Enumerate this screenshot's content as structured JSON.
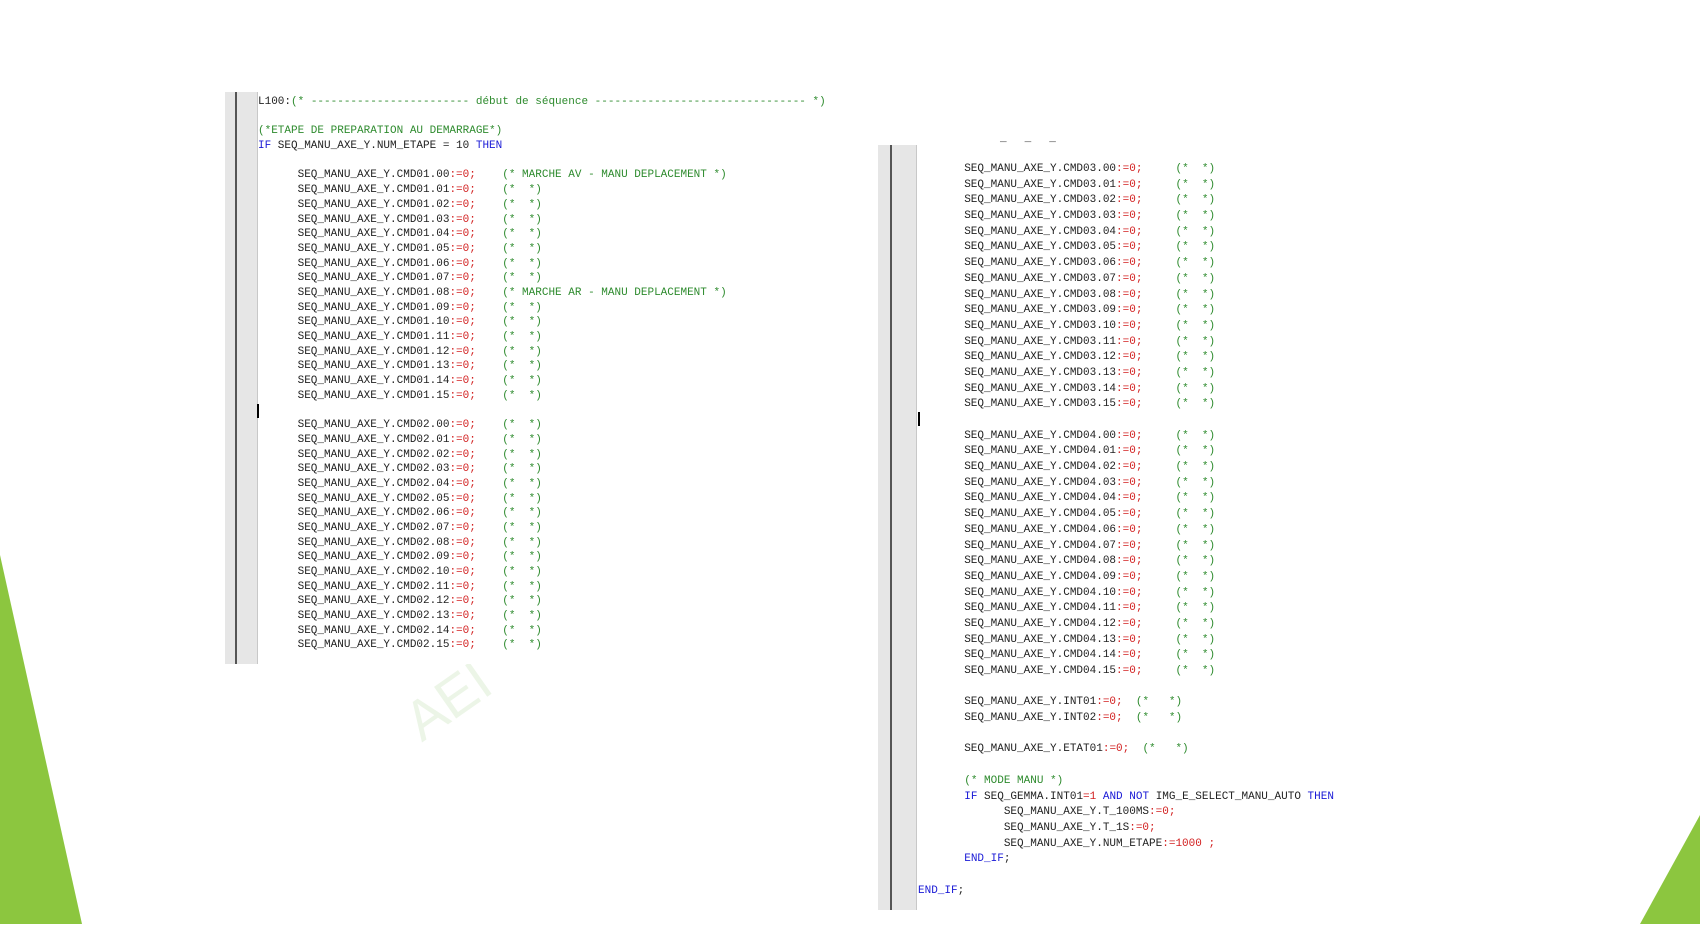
{
  "watermark": "AEI",
  "colors": {
    "comment": "#2e8b2e",
    "keyword": "#1a1ad6",
    "number": "#d22020",
    "text": "#222222",
    "accent_green": "#8cc63f"
  },
  "left_code": [
    [
      [
        "L100:",
        "p"
      ],
      [
        "(* ------------------------ début de séquence -------------------------------- *)",
        "c"
      ]
    ],
    [],
    [
      [
        "(*ETAPE DE PREPARATION AU DEMARRAGE*)",
        "c"
      ]
    ],
    [
      [
        "IF",
        "k"
      ],
      [
        " SEQ_MANU_AXE_Y.NUM_ETAPE = 10 ",
        "p"
      ],
      [
        "THEN",
        "k"
      ]
    ],
    [],
    [
      [
        "      SEQ_MANU_AXE_Y.CMD01.00",
        "p"
      ],
      [
        ":=0;",
        "n"
      ],
      [
        "    ",
        "p"
      ],
      [
        "(* MARCHE AV - MANU DEPLACEMENT *)",
        "c"
      ]
    ],
    [
      [
        "      SEQ_MANU_AXE_Y.CMD01.01",
        "p"
      ],
      [
        ":=0;",
        "n"
      ],
      [
        "    ",
        "p"
      ],
      [
        "(*  *)",
        "c"
      ]
    ],
    [
      [
        "      SEQ_MANU_AXE_Y.CMD01.02",
        "p"
      ],
      [
        ":=0;",
        "n"
      ],
      [
        "    ",
        "p"
      ],
      [
        "(*  *)",
        "c"
      ]
    ],
    [
      [
        "      SEQ_MANU_AXE_Y.CMD01.03",
        "p"
      ],
      [
        ":=0;",
        "n"
      ],
      [
        "    ",
        "p"
      ],
      [
        "(*  *)",
        "c"
      ]
    ],
    [
      [
        "      SEQ_MANU_AXE_Y.CMD01.04",
        "p"
      ],
      [
        ":=0;",
        "n"
      ],
      [
        "    ",
        "p"
      ],
      [
        "(*  *)",
        "c"
      ]
    ],
    [
      [
        "      SEQ_MANU_AXE_Y.CMD01.05",
        "p"
      ],
      [
        ":=0;",
        "n"
      ],
      [
        "    ",
        "p"
      ],
      [
        "(*  *)",
        "c"
      ]
    ],
    [
      [
        "      SEQ_MANU_AXE_Y.CMD01.06",
        "p"
      ],
      [
        ":=0;",
        "n"
      ],
      [
        "    ",
        "p"
      ],
      [
        "(*  *)",
        "c"
      ]
    ],
    [
      [
        "      SEQ_MANU_AXE_Y.CMD01.07",
        "p"
      ],
      [
        ":=0;",
        "n"
      ],
      [
        "    ",
        "p"
      ],
      [
        "(*  *)",
        "c"
      ]
    ],
    [
      [
        "      SEQ_MANU_AXE_Y.CMD01.08",
        "p"
      ],
      [
        ":=0;",
        "n"
      ],
      [
        "    ",
        "p"
      ],
      [
        "(* MARCHE AR - MANU DEPLACEMENT *)",
        "c"
      ]
    ],
    [
      [
        "      SEQ_MANU_AXE_Y.CMD01.09",
        "p"
      ],
      [
        ":=0;",
        "n"
      ],
      [
        "    ",
        "p"
      ],
      [
        "(*  *)",
        "c"
      ]
    ],
    [
      [
        "      SEQ_MANU_AXE_Y.CMD01.10",
        "p"
      ],
      [
        ":=0;",
        "n"
      ],
      [
        "    ",
        "p"
      ],
      [
        "(*  *)",
        "c"
      ]
    ],
    [
      [
        "      SEQ_MANU_AXE_Y.CMD01.11",
        "p"
      ],
      [
        ":=0;",
        "n"
      ],
      [
        "    ",
        "p"
      ],
      [
        "(*  *)",
        "c"
      ]
    ],
    [
      [
        "      SEQ_MANU_AXE_Y.CMD01.12",
        "p"
      ],
      [
        ":=0;",
        "n"
      ],
      [
        "    ",
        "p"
      ],
      [
        "(*  *)",
        "c"
      ]
    ],
    [
      [
        "      SEQ_MANU_AXE_Y.CMD01.13",
        "p"
      ],
      [
        ":=0;",
        "n"
      ],
      [
        "    ",
        "p"
      ],
      [
        "(*  *)",
        "c"
      ]
    ],
    [
      [
        "      SEQ_MANU_AXE_Y.CMD01.14",
        "p"
      ],
      [
        ":=0;",
        "n"
      ],
      [
        "    ",
        "p"
      ],
      [
        "(*  *)",
        "c"
      ]
    ],
    [
      [
        "      SEQ_MANU_AXE_Y.CMD01.15",
        "p"
      ],
      [
        ":=0;",
        "n"
      ],
      [
        "    ",
        "p"
      ],
      [
        "(*  *)",
        "c"
      ]
    ],
    [],
    [
      [
        "      SEQ_MANU_AXE_Y.CMD02.00",
        "p"
      ],
      [
        ":=0;",
        "n"
      ],
      [
        "    ",
        "p"
      ],
      [
        "(*  *)",
        "c"
      ]
    ],
    [
      [
        "      SEQ_MANU_AXE_Y.CMD02.01",
        "p"
      ],
      [
        ":=0;",
        "n"
      ],
      [
        "    ",
        "p"
      ],
      [
        "(*  *)",
        "c"
      ]
    ],
    [
      [
        "      SEQ_MANU_AXE_Y.CMD02.02",
        "p"
      ],
      [
        ":=0;",
        "n"
      ],
      [
        "    ",
        "p"
      ],
      [
        "(*  *)",
        "c"
      ]
    ],
    [
      [
        "      SEQ_MANU_AXE_Y.CMD02.03",
        "p"
      ],
      [
        ":=0;",
        "n"
      ],
      [
        "    ",
        "p"
      ],
      [
        "(*  *)",
        "c"
      ]
    ],
    [
      [
        "      SEQ_MANU_AXE_Y.CMD02.04",
        "p"
      ],
      [
        ":=0;",
        "n"
      ],
      [
        "    ",
        "p"
      ],
      [
        "(*  *)",
        "c"
      ]
    ],
    [
      [
        "      SEQ_MANU_AXE_Y.CMD02.05",
        "p"
      ],
      [
        ":=0;",
        "n"
      ],
      [
        "    ",
        "p"
      ],
      [
        "(*  *)",
        "c"
      ]
    ],
    [
      [
        "      SEQ_MANU_AXE_Y.CMD02.06",
        "p"
      ],
      [
        ":=0;",
        "n"
      ],
      [
        "    ",
        "p"
      ],
      [
        "(*  *)",
        "c"
      ]
    ],
    [
      [
        "      SEQ_MANU_AXE_Y.CMD02.07",
        "p"
      ],
      [
        ":=0;",
        "n"
      ],
      [
        "    ",
        "p"
      ],
      [
        "(*  *)",
        "c"
      ]
    ],
    [
      [
        "      SEQ_MANU_AXE_Y.CMD02.08",
        "p"
      ],
      [
        ":=0;",
        "n"
      ],
      [
        "    ",
        "p"
      ],
      [
        "(*  *)",
        "c"
      ]
    ],
    [
      [
        "      SEQ_MANU_AXE_Y.CMD02.09",
        "p"
      ],
      [
        ":=0;",
        "n"
      ],
      [
        "    ",
        "p"
      ],
      [
        "(*  *)",
        "c"
      ]
    ],
    [
      [
        "      SEQ_MANU_AXE_Y.CMD02.10",
        "p"
      ],
      [
        ":=0;",
        "n"
      ],
      [
        "    ",
        "p"
      ],
      [
        "(*  *)",
        "c"
      ]
    ],
    [
      [
        "      SEQ_MANU_AXE_Y.CMD02.11",
        "p"
      ],
      [
        ":=0;",
        "n"
      ],
      [
        "    ",
        "p"
      ],
      [
        "(*  *)",
        "c"
      ]
    ],
    [
      [
        "      SEQ_MANU_AXE_Y.CMD02.12",
        "p"
      ],
      [
        ":=0;",
        "n"
      ],
      [
        "    ",
        "p"
      ],
      [
        "(*  *)",
        "c"
      ]
    ],
    [
      [
        "      SEQ_MANU_AXE_Y.CMD02.13",
        "p"
      ],
      [
        ":=0;",
        "n"
      ],
      [
        "    ",
        "p"
      ],
      [
        "(*  *)",
        "c"
      ]
    ],
    [
      [
        "      SEQ_MANU_AXE_Y.CMD02.14",
        "p"
      ],
      [
        ":=0;",
        "n"
      ],
      [
        "    ",
        "p"
      ],
      [
        "(*  *)",
        "c"
      ]
    ],
    [
      [
        "      SEQ_MANU_AXE_Y.CMD02.15",
        "p"
      ],
      [
        ":=0;",
        "n"
      ],
      [
        "    ",
        "p"
      ],
      [
        "(*  *)",
        "c"
      ]
    ]
  ],
  "right_code": [
    [
      [
        "       SEQ_MANU_AXE_Y.CMD03.00",
        "p"
      ],
      [
        ":=0;",
        "n"
      ],
      [
        "     ",
        "p"
      ],
      [
        "(*  *)",
        "c"
      ]
    ],
    [
      [
        "       SEQ_MANU_AXE_Y.CMD03.01",
        "p"
      ],
      [
        ":=0;",
        "n"
      ],
      [
        "     ",
        "p"
      ],
      [
        "(*  *)",
        "c"
      ]
    ],
    [
      [
        "       SEQ_MANU_AXE_Y.CMD03.02",
        "p"
      ],
      [
        ":=0;",
        "n"
      ],
      [
        "     ",
        "p"
      ],
      [
        "(*  *)",
        "c"
      ]
    ],
    [
      [
        "       SEQ_MANU_AXE_Y.CMD03.03",
        "p"
      ],
      [
        ":=0;",
        "n"
      ],
      [
        "     ",
        "p"
      ],
      [
        "(*  *)",
        "c"
      ]
    ],
    [
      [
        "       SEQ_MANU_AXE_Y.CMD03.04",
        "p"
      ],
      [
        ":=0;",
        "n"
      ],
      [
        "     ",
        "p"
      ],
      [
        "(*  *)",
        "c"
      ]
    ],
    [
      [
        "       SEQ_MANU_AXE_Y.CMD03.05",
        "p"
      ],
      [
        ":=0;",
        "n"
      ],
      [
        "     ",
        "p"
      ],
      [
        "(*  *)",
        "c"
      ]
    ],
    [
      [
        "       SEQ_MANU_AXE_Y.CMD03.06",
        "p"
      ],
      [
        ":=0;",
        "n"
      ],
      [
        "     ",
        "p"
      ],
      [
        "(*  *)",
        "c"
      ]
    ],
    [
      [
        "       SEQ_MANU_AXE_Y.CMD03.07",
        "p"
      ],
      [
        ":=0;",
        "n"
      ],
      [
        "     ",
        "p"
      ],
      [
        "(*  *)",
        "c"
      ]
    ],
    [
      [
        "       SEQ_MANU_AXE_Y.CMD03.08",
        "p"
      ],
      [
        ":=0;",
        "n"
      ],
      [
        "     ",
        "p"
      ],
      [
        "(*  *)",
        "c"
      ]
    ],
    [
      [
        "       SEQ_MANU_AXE_Y.CMD03.09",
        "p"
      ],
      [
        ":=0;",
        "n"
      ],
      [
        "     ",
        "p"
      ],
      [
        "(*  *)",
        "c"
      ]
    ],
    [
      [
        "       SEQ_MANU_AXE_Y.CMD03.10",
        "p"
      ],
      [
        ":=0;",
        "n"
      ],
      [
        "     ",
        "p"
      ],
      [
        "(*  *)",
        "c"
      ]
    ],
    [
      [
        "       SEQ_MANU_AXE_Y.CMD03.11",
        "p"
      ],
      [
        ":=0;",
        "n"
      ],
      [
        "     ",
        "p"
      ],
      [
        "(*  *)",
        "c"
      ]
    ],
    [
      [
        "       SEQ_MANU_AXE_Y.CMD03.12",
        "p"
      ],
      [
        ":=0;",
        "n"
      ],
      [
        "     ",
        "p"
      ],
      [
        "(*  *)",
        "c"
      ]
    ],
    [
      [
        "       SEQ_MANU_AXE_Y.CMD03.13",
        "p"
      ],
      [
        ":=0;",
        "n"
      ],
      [
        "     ",
        "p"
      ],
      [
        "(*  *)",
        "c"
      ]
    ],
    [
      [
        "       SEQ_MANU_AXE_Y.CMD03.14",
        "p"
      ],
      [
        ":=0;",
        "n"
      ],
      [
        "     ",
        "p"
      ],
      [
        "(*  *)",
        "c"
      ]
    ],
    [
      [
        "       SEQ_MANU_AXE_Y.CMD03.15",
        "p"
      ],
      [
        ":=0;",
        "n"
      ],
      [
        "     ",
        "p"
      ],
      [
        "(*  *)",
        "c"
      ]
    ],
    [],
    [
      [
        "       SEQ_MANU_AXE_Y.CMD04.00",
        "p"
      ],
      [
        ":=0;",
        "n"
      ],
      [
        "     ",
        "p"
      ],
      [
        "(*  *)",
        "c"
      ]
    ],
    [
      [
        "       SEQ_MANU_AXE_Y.CMD04.01",
        "p"
      ],
      [
        ":=0;",
        "n"
      ],
      [
        "     ",
        "p"
      ],
      [
        "(*  *)",
        "c"
      ]
    ],
    [
      [
        "       SEQ_MANU_AXE_Y.CMD04.02",
        "p"
      ],
      [
        ":=0;",
        "n"
      ],
      [
        "     ",
        "p"
      ],
      [
        "(*  *)",
        "c"
      ]
    ],
    [
      [
        "       SEQ_MANU_AXE_Y.CMD04.03",
        "p"
      ],
      [
        ":=0;",
        "n"
      ],
      [
        "     ",
        "p"
      ],
      [
        "(*  *)",
        "c"
      ]
    ],
    [
      [
        "       SEQ_MANU_AXE_Y.CMD04.04",
        "p"
      ],
      [
        ":=0;",
        "n"
      ],
      [
        "     ",
        "p"
      ],
      [
        "(*  *)",
        "c"
      ]
    ],
    [
      [
        "       SEQ_MANU_AXE_Y.CMD04.05",
        "p"
      ],
      [
        ":=0;",
        "n"
      ],
      [
        "     ",
        "p"
      ],
      [
        "(*  *)",
        "c"
      ]
    ],
    [
      [
        "       SEQ_MANU_AXE_Y.CMD04.06",
        "p"
      ],
      [
        ":=0;",
        "n"
      ],
      [
        "     ",
        "p"
      ],
      [
        "(*  *)",
        "c"
      ]
    ],
    [
      [
        "       SEQ_MANU_AXE_Y.CMD04.07",
        "p"
      ],
      [
        ":=0;",
        "n"
      ],
      [
        "     ",
        "p"
      ],
      [
        "(*  *)",
        "c"
      ]
    ],
    [
      [
        "       SEQ_MANU_AXE_Y.CMD04.08",
        "p"
      ],
      [
        ":=0;",
        "n"
      ],
      [
        "     ",
        "p"
      ],
      [
        "(*  *)",
        "c"
      ]
    ],
    [
      [
        "       SEQ_MANU_AXE_Y.CMD04.09",
        "p"
      ],
      [
        ":=0;",
        "n"
      ],
      [
        "     ",
        "p"
      ],
      [
        "(*  *)",
        "c"
      ]
    ],
    [
      [
        "       SEQ_MANU_AXE_Y.CMD04.10",
        "p"
      ],
      [
        ":=0;",
        "n"
      ],
      [
        "     ",
        "p"
      ],
      [
        "(*  *)",
        "c"
      ]
    ],
    [
      [
        "       SEQ_MANU_AXE_Y.CMD04.11",
        "p"
      ],
      [
        ":=0;",
        "n"
      ],
      [
        "     ",
        "p"
      ],
      [
        "(*  *)",
        "c"
      ]
    ],
    [
      [
        "       SEQ_MANU_AXE_Y.CMD04.12",
        "p"
      ],
      [
        ":=0;",
        "n"
      ],
      [
        "     ",
        "p"
      ],
      [
        "(*  *)",
        "c"
      ]
    ],
    [
      [
        "       SEQ_MANU_AXE_Y.CMD04.13",
        "p"
      ],
      [
        ":=0;",
        "n"
      ],
      [
        "     ",
        "p"
      ],
      [
        "(*  *)",
        "c"
      ]
    ],
    [
      [
        "       SEQ_MANU_AXE_Y.CMD04.14",
        "p"
      ],
      [
        ":=0;",
        "n"
      ],
      [
        "     ",
        "p"
      ],
      [
        "(*  *)",
        "c"
      ]
    ],
    [
      [
        "       SEQ_MANU_AXE_Y.CMD04.15",
        "p"
      ],
      [
        ":=0;",
        "n"
      ],
      [
        "     ",
        "p"
      ],
      [
        "(*  *)",
        "c"
      ]
    ],
    [],
    [
      [
        "       SEQ_MANU_AXE_Y.INT01",
        "p"
      ],
      [
        ":=0;",
        "n"
      ],
      [
        "  ",
        "p"
      ],
      [
        "(*   *)",
        "c"
      ]
    ],
    [
      [
        "       SEQ_MANU_AXE_Y.INT02",
        "p"
      ],
      [
        ":=0;",
        "n"
      ],
      [
        "  ",
        "p"
      ],
      [
        "(*   *)",
        "c"
      ]
    ],
    [],
    [
      [
        "       SEQ_MANU_AXE_Y.ETAT01",
        "p"
      ],
      [
        ":=0;",
        "n"
      ],
      [
        "  ",
        "p"
      ],
      [
        "(*   *)",
        "c"
      ]
    ],
    [],
    [
      [
        "       ",
        "p"
      ],
      [
        "(* MODE MANU *)",
        "c"
      ]
    ],
    [
      [
        "       ",
        "p"
      ],
      [
        "IF",
        "k"
      ],
      [
        " SEQ_GEMMA.INT01",
        "p"
      ],
      [
        "=1",
        "n"
      ],
      [
        " ",
        "p"
      ],
      [
        "AND",
        "k"
      ],
      [
        " ",
        "p"
      ],
      [
        "NOT",
        "k"
      ],
      [
        " IMG_E_SELECT_MANU_AUTO ",
        "p"
      ],
      [
        "THEN",
        "k"
      ]
    ],
    [
      [
        "             SEQ_MANU_AXE_Y.T_100MS",
        "p"
      ],
      [
        ":=0;",
        "n"
      ]
    ],
    [
      [
        "             SEQ_MANU_AXE_Y.T_1S",
        "p"
      ],
      [
        ":=0;",
        "n"
      ]
    ],
    [
      [
        "             SEQ_MANU_AXE_Y.NUM_ETAPE",
        "p"
      ],
      [
        ":=1000 ;",
        "n"
      ]
    ],
    [
      [
        "       ",
        "p"
      ],
      [
        "END_IF",
        "k"
      ],
      [
        ";",
        "p"
      ]
    ],
    [],
    [
      [
        "END_IF",
        "k"
      ],
      [
        ";",
        "p"
      ]
    ]
  ]
}
